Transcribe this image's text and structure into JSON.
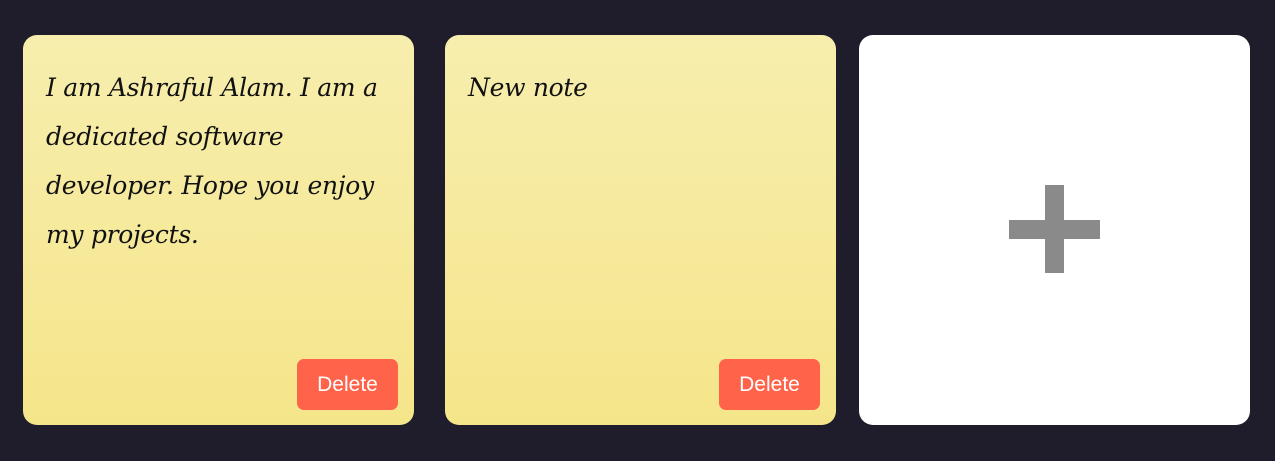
{
  "notes": [
    {
      "text": "I am Ashraful Alam. I am a dedicated software developer. Hope you enjoy my projects.",
      "delete_label": "Delete"
    },
    {
      "text": "New note",
      "delete_label": "Delete"
    }
  ],
  "add_note": {
    "icon": "plus-icon"
  },
  "colors": {
    "background": "#1f1d2b",
    "note_top": "#f7eeae",
    "note_bottom": "#f5e58a",
    "delete_button": "#ff634a",
    "add_card": "#ffffff",
    "plus_icon": "#8a8a8a"
  }
}
